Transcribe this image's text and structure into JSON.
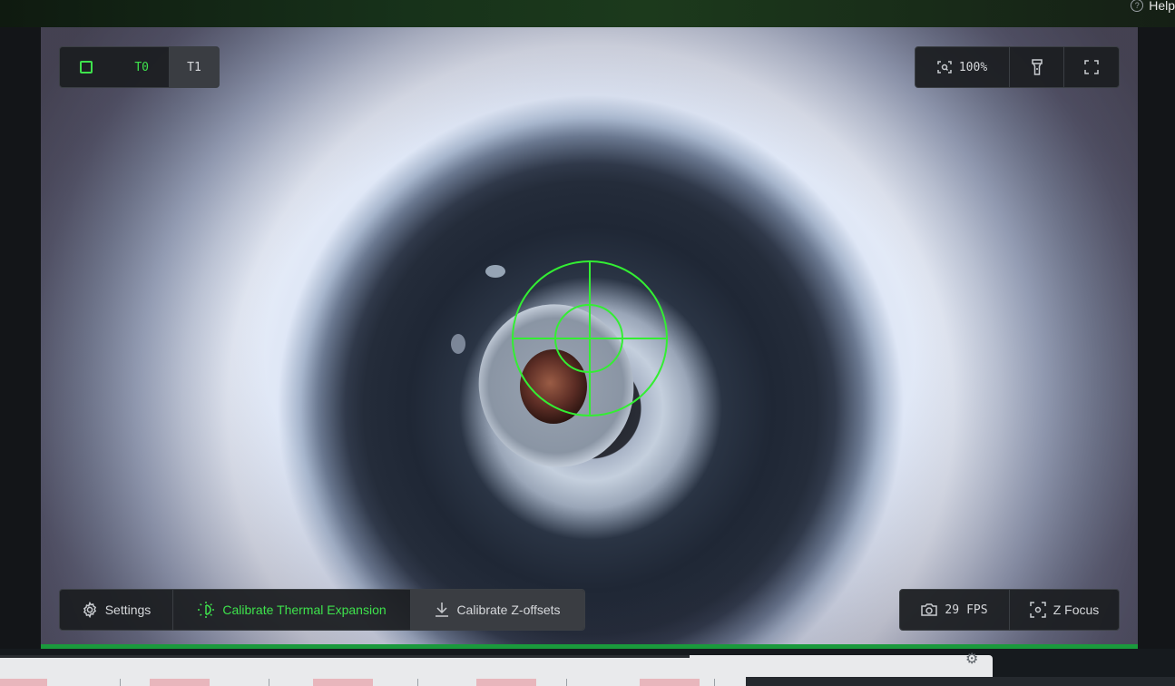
{
  "header": {
    "help_label": "Help"
  },
  "top_left_toolbar": {
    "tools": [
      {
        "label": "T0",
        "icon": "square-icon",
        "active": true
      },
      {
        "label": "T1",
        "active": false
      }
    ]
  },
  "top_right_toolbar": {
    "zoom_label": "100%",
    "zoom_icon": "zoom-icon",
    "light_icon": "flashlight-icon",
    "fullscreen_icon": "fullscreen-icon"
  },
  "bottom_left_toolbar": {
    "settings_label": "Settings",
    "calibrate_thermal_label": "Calibrate Thermal Expansion",
    "calibrate_z_label": "Calibrate Z-offsets"
  },
  "bottom_right_toolbar": {
    "fps_value": "29",
    "fps_unit": "FPS",
    "z_focus_label": "Z Focus"
  },
  "colors": {
    "accent_green": "#3ee24c",
    "crosshair_green": "#33ee33",
    "toolbar_bg": "#1c1e21"
  }
}
